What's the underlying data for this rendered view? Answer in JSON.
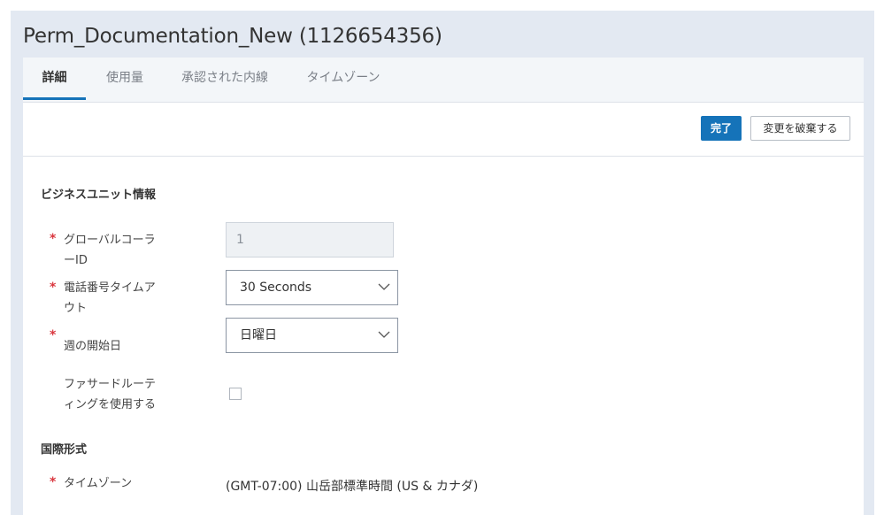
{
  "page": {
    "title": "Perm_Documentation_New (1126654356)"
  },
  "tabs": [
    {
      "label": "詳細"
    },
    {
      "label": "使用量"
    },
    {
      "label": "承認された内線"
    },
    {
      "label": "タイムゾーン"
    }
  ],
  "toolbar": {
    "done_label": "完了",
    "discard_label": "変更を破棄する"
  },
  "business_unit": {
    "title": "ビジネスユニット情報",
    "global_caller_id": {
      "label_line1": "グローバルコーラ",
      "label_line2": "ーID",
      "value": "1"
    },
    "phone_timeout": {
      "label_line1": "電話番号タイムア",
      "label_line2": "ウト",
      "value": "30 Seconds"
    },
    "week_start": {
      "label": "週の開始日",
      "value": "日曜日"
    },
    "facade_routing": {
      "label_line1": "ファサードルーテ",
      "label_line2": "ィングを使用する",
      "checked": false
    }
  },
  "international": {
    "title": "国際形式",
    "timezone": {
      "label": "タイムゾーン",
      "value": "(GMT-07:00) 山岳部標準時間 (US & カナダ)"
    }
  },
  "colors": {
    "accent": "#1573b9",
    "required": "#d9363e",
    "background": "#e3e9f2"
  }
}
